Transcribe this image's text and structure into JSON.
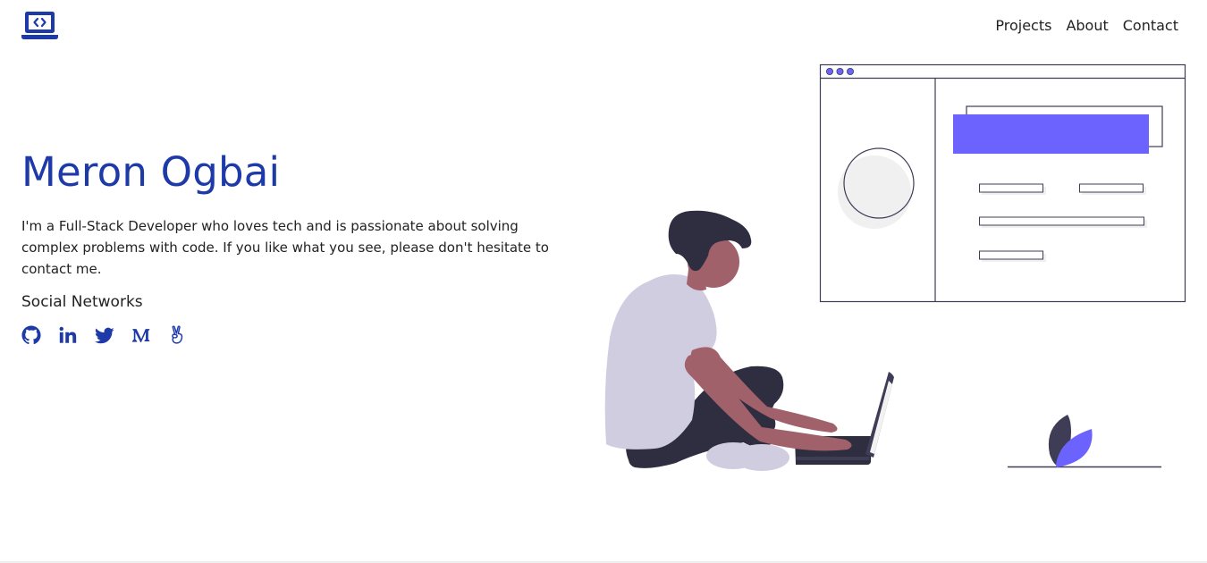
{
  "header": {
    "logo_icon": "laptop-code-icon",
    "nav": [
      {
        "label": "Projects"
      },
      {
        "label": "About"
      },
      {
        "label": "Contact"
      }
    ]
  },
  "hero": {
    "name": "Meron Ogbai",
    "bio": "I'm a Full-Stack Developer who loves tech and is passionate about solving complex problems with code. If you like what you see, please don't hesitate to contact me.",
    "social_heading": "Social Networks",
    "social_icons": [
      "github-icon",
      "linkedin-icon",
      "twitter-icon",
      "medium-icon",
      "angellist-icon"
    ]
  },
  "colors": {
    "accent": "#1d3aa8",
    "illustration_accent": "#6c63ff",
    "text": "#222222"
  }
}
